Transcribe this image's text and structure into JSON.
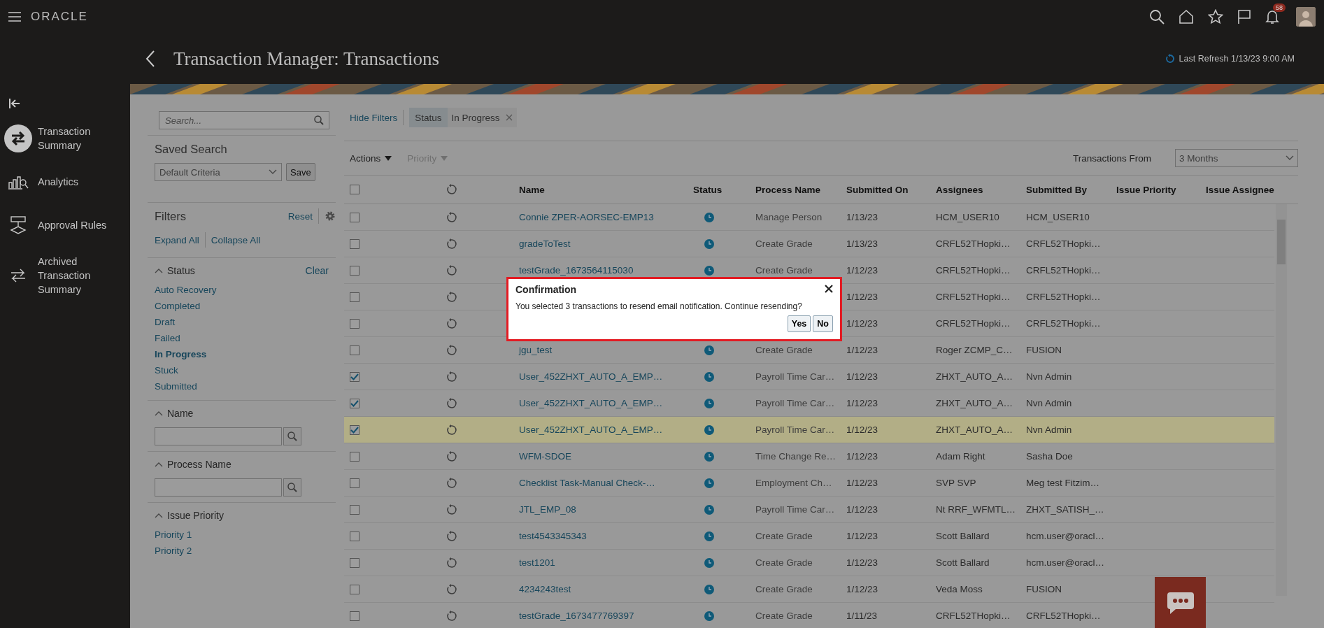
{
  "top_bar": {
    "logo": "ORACLE",
    "notification_count": "58"
  },
  "page": {
    "title": "Transaction Manager: Transactions",
    "last_refresh": "Last Refresh 1/13/23 9:00 AM"
  },
  "nav": [
    {
      "kind": "swap",
      "label": "Transaction Summary",
      "selected": true
    },
    {
      "kind": "chart",
      "label": "Analytics",
      "selected": false
    },
    {
      "kind": "rules",
      "label": "Approval Rules",
      "selected": false
    },
    {
      "kind": "archive",
      "label": "Archived Transaction Summary",
      "selected": false
    }
  ],
  "filter_panel": {
    "search_placeholder": "Search...",
    "saved_search_title": "Saved Search",
    "saved_search_value": "Default Criteria",
    "save_button": "Save",
    "filters_title": "Filters",
    "reset": "Reset",
    "expand_all": "Expand All",
    "collapse_all": "Collapse All",
    "sections": [
      {
        "kind": "list",
        "title": "Status",
        "clear": "Clear",
        "items": [
          {
            "label": "Auto Recovery",
            "selected": false
          },
          {
            "label": "Completed",
            "selected": false
          },
          {
            "label": "Draft",
            "selected": false
          },
          {
            "label": "Failed",
            "selected": false
          },
          {
            "label": "In Progress",
            "selected": true
          },
          {
            "label": "Stuck",
            "selected": false
          },
          {
            "label": "Submitted",
            "selected": false
          }
        ]
      },
      {
        "kind": "search",
        "title": "Name"
      },
      {
        "kind": "search",
        "title": "Process Name"
      },
      {
        "kind": "list",
        "title": "Issue Priority",
        "items": [
          {
            "label": "Priority 1",
            "selected": false
          },
          {
            "label": "Priority 2",
            "selected": false
          }
        ]
      }
    ]
  },
  "toolbar": {
    "hide_filters": "Hide Filters",
    "chip_label": "Status",
    "chip_value": "In Progress",
    "actions": {
      "label": "Actions",
      "disabled": false
    },
    "priority": {
      "label": "Priority",
      "disabled": true
    },
    "range_label": "Transactions From",
    "range_value": "3 Months"
  },
  "table": {
    "columns": [
      "Name",
      "Status",
      "Process Name",
      "Submitted On",
      "Assignees",
      "Submitted By",
      "Issue Priority",
      "Issue Assignee"
    ],
    "header_checked": false,
    "rows": [
      {
        "checked": false,
        "selected": false,
        "name": "Connie ZPER-AORSEC-EMP13",
        "status_in_progress": true,
        "process": "Manage Person",
        "submitted_on": "1/13/23",
        "assignees": "HCM_USER10",
        "submitted_by": "HCM_USER10"
      },
      {
        "checked": false,
        "selected": false,
        "name": "gradeToTest",
        "status_in_progress": true,
        "process": "Create Grade",
        "submitted_on": "1/13/23",
        "assignees": "CRFL52THopki…",
        "submitted_by": "CRFL52THopki…"
      },
      {
        "checked": false,
        "selected": false,
        "name": "testGrade_1673564115030",
        "status_in_progress": true,
        "process": "Create Grade",
        "submitted_on": "1/12/23",
        "assignees": "CRFL52THopki…",
        "submitted_by": "CRFL52THopki…"
      },
      {
        "checked": false,
        "selected": false,
        "submitted_on": "1/12/23",
        "assignees": "CRFL52THopki…",
        "submitted_by": "CRFL52THopki…"
      },
      {
        "checked": false,
        "selected": false,
        "submitted_on": "1/12/23",
        "assignees": "CRFL52THopki…",
        "submitted_by": "CRFL52THopki…"
      },
      {
        "checked": false,
        "selected": false,
        "name": "jgu_test",
        "status_in_progress": true,
        "process": "Create Grade",
        "submitted_on": "1/12/23",
        "assignees": "Roger ZCMP_C…",
        "submitted_by": "FUSION"
      },
      {
        "checked": true,
        "selected": false,
        "name": "User_452ZHXT_AUTO_A_EMP…",
        "status_in_progress": true,
        "process": "Payroll Time Car…",
        "submitted_on": "1/12/23",
        "assignees": "ZHXT_AUTO_A…",
        "submitted_by": "Nvn Admin"
      },
      {
        "checked": true,
        "selected": false,
        "name": "User_452ZHXT_AUTO_A_EMP…",
        "status_in_progress": true,
        "process": "Payroll Time Car…",
        "submitted_on": "1/12/23",
        "assignees": "ZHXT_AUTO_A…",
        "submitted_by": "Nvn Admin"
      },
      {
        "checked": true,
        "selected": true,
        "name": "User_452ZHXT_AUTO_A_EMP…",
        "status_in_progress": true,
        "process": "Payroll Time Car…",
        "submitted_on": "1/12/23",
        "assignees": "ZHXT_AUTO_A…",
        "submitted_by": "Nvn Admin"
      },
      {
        "checked": false,
        "selected": false,
        "name": "WFM-SDOE",
        "status_in_progress": true,
        "process": "Time Change Re…",
        "submitted_on": "1/12/23",
        "assignees": "Adam Right",
        "submitted_by": "Sasha Doe"
      },
      {
        "checked": false,
        "selected": false,
        "name": "Checklist Task-Manual Check-…",
        "status_in_progress": true,
        "process": "Employment Ch…",
        "submitted_on": "1/12/23",
        "assignees": "SVP SVP",
        "submitted_by": "Meg test Fitzim…"
      },
      {
        "checked": false,
        "selected": false,
        "name": "JTL_EMP_08",
        "status_in_progress": true,
        "process": "Payroll Time Car…",
        "submitted_on": "1/12/23",
        "assignees": "Nt RRF_WFMTL…",
        "submitted_by": "ZHXT_SATISH_…"
      },
      {
        "checked": false,
        "selected": false,
        "name": "test4543345343",
        "status_in_progress": true,
        "process": "Create Grade",
        "submitted_on": "1/12/23",
        "assignees": "Scott Ballard",
        "submitted_by": "hcm.user@oracl…"
      },
      {
        "checked": false,
        "selected": false,
        "name": "test1201",
        "status_in_progress": true,
        "process": "Create Grade",
        "submitted_on": "1/12/23",
        "assignees": "Scott Ballard",
        "submitted_by": "hcm.user@oracl…"
      },
      {
        "checked": false,
        "selected": false,
        "name": "4234243test",
        "status_in_progress": true,
        "process": "Create Grade",
        "submitted_on": "1/12/23",
        "assignees": "Veda Moss",
        "submitted_by": "FUSION"
      },
      {
        "checked": false,
        "selected": false,
        "name": "testGrade_1673477769397",
        "status_in_progress": true,
        "process": "Create Grade",
        "submitted_on": "1/11/23",
        "assignees": "CRFL52THopki…",
        "submitted_by": "CRFL52THopki…"
      }
    ]
  },
  "dialog": {
    "title": "Confirmation",
    "message": "You selected 3 transactions to resend email notification. Continue resending?",
    "buttons": [
      "Yes",
      "No"
    ]
  }
}
